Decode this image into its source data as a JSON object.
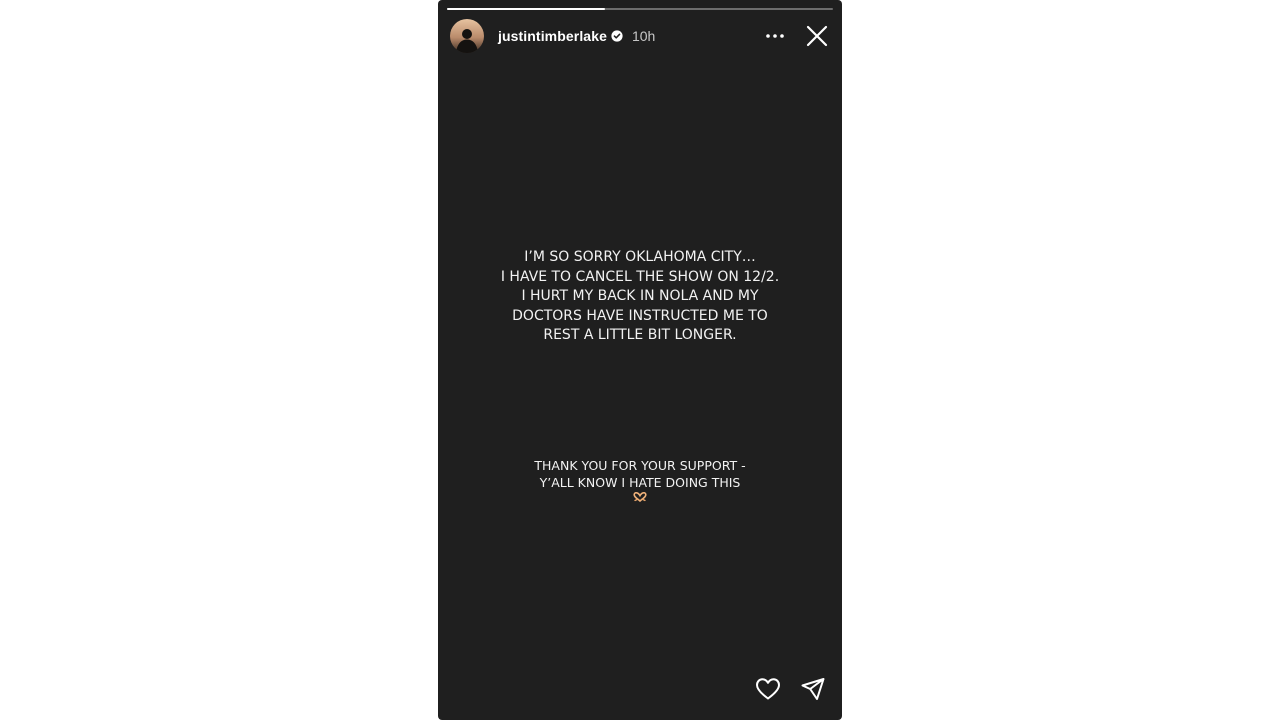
{
  "story": {
    "progress": 0.41,
    "author": {
      "username": "justintimberlake",
      "verified": true,
      "time_ago": "10h",
      "avatar": "profile-photo"
    },
    "header_icons": {
      "more": "more-horizontal-icon",
      "close": "close-icon"
    },
    "message_lines": [
      "I’M SO SORRY OKLAHOMA CITY…",
      "I HAVE TO CANCEL THE SHOW ON 12/2.",
      "I HURT MY BACK IN NOLA AND MY",
      "DOCTORS HAVE INSTRUCTED ME TO",
      "REST A LITTLE BIT LONGER."
    ],
    "thanks_lines": [
      "THANK YOU FOR YOUR SUPPORT -",
      "Y’ALL KNOW I HATE DOING THIS"
    ],
    "emoji": "heart-hands-emoji",
    "action_icons": {
      "like": "heart-icon",
      "share": "send-icon"
    },
    "colors": {
      "background": "#1f1f1f",
      "text": "#f2f2f2",
      "page": "#ffffff"
    }
  }
}
